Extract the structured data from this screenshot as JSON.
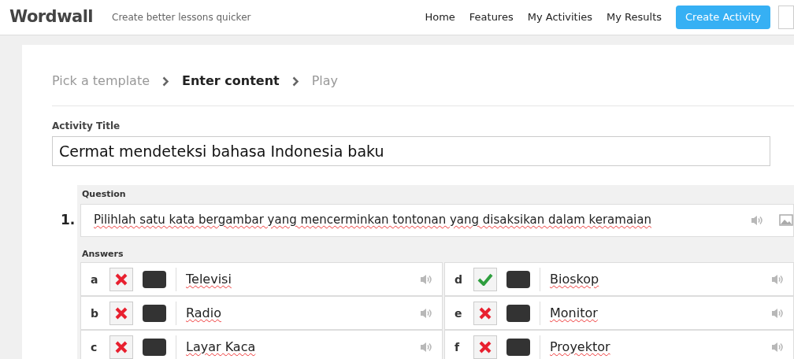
{
  "header": {
    "logo": "Wordwall",
    "tagline": "Create better lessons quicker",
    "nav": [
      "Home",
      "Features",
      "My Activities",
      "My Results"
    ],
    "cta": "Create Activity"
  },
  "breadcrumb": [
    {
      "label": "Pick a template",
      "selected": false
    },
    {
      "label": "Enter content",
      "selected": true
    },
    {
      "label": "Play",
      "selected": false
    }
  ],
  "activity_title": {
    "label": "Activity Title",
    "value": "Cermat mendeteksi bahasa Indonesia baku"
  },
  "question": {
    "number": "1.",
    "label": "Question",
    "value": "Pilihlah satu kata bergambar yang mencerminkan tontonan yang disaksikan dalam keramaian",
    "answers_label": "Answers",
    "answers": [
      {
        "letter": "a",
        "correct": false,
        "text": "Televisi"
      },
      {
        "letter": "d",
        "correct": true,
        "text": "Bioskop"
      },
      {
        "letter": "b",
        "correct": false,
        "text": "Radio"
      },
      {
        "letter": "e",
        "correct": false,
        "text": "Monitor"
      },
      {
        "letter": "c",
        "correct": false,
        "text": "Layar Kaca"
      },
      {
        "letter": "f",
        "correct": false,
        "text": "Proyektor"
      }
    ]
  }
}
